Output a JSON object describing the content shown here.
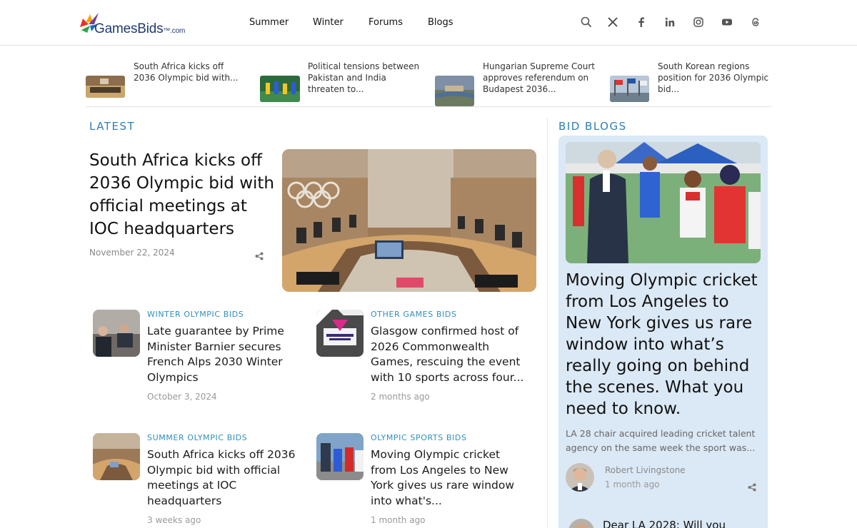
{
  "header": {
    "logo_text": "GamesBids",
    "logo_tld": "™.com",
    "nav": [
      "Summer",
      "Winter",
      "Forums",
      "Blogs"
    ],
    "icons": [
      "search-icon",
      "x-icon",
      "facebook-icon",
      "linkedin-icon",
      "instagram-icon",
      "youtube-icon",
      "threads-icon"
    ]
  },
  "ticker": [
    {
      "text": "South Africa kicks off 2036 Olympic bid with..."
    },
    {
      "text": "Political tensions between Pakistan and India threaten to..."
    },
    {
      "text": "Hungarian Supreme Court approves referendum on Budapest 2036..."
    },
    {
      "text": "South Korean regions position for 2036 Olympic bid..."
    }
  ],
  "latest": {
    "heading": "LATEST",
    "featured": {
      "title": "South Africa kicks off 2036 Olympic bid with official meetings at IOC headquarters",
      "date": "November 22, 2024"
    },
    "cards": [
      {
        "category": "WINTER OLYMPIC BIDS",
        "title": "Late guarantee by Prime Minister Barnier secures French Alps 2030 Winter Olympics",
        "date": "October 3, 2024"
      },
      {
        "category": "OTHER GAMES BIDS",
        "title": "Glasgow confirmed host of 2026 Commonwealth Games, rescuing the event with 10 sports across four...",
        "date": "2 months ago"
      },
      {
        "category": "SUMMER OLYMPIC BIDS",
        "title": "South Africa kicks off 2036 Olympic bid with official meetings at IOC headquarters",
        "date": "3 weeks ago"
      },
      {
        "category": "OLYMPIC SPORTS BIDS",
        "title": "Moving Olympic cricket from Los Angeles to New York gives us rare window into what's...",
        "date": "1 month ago"
      }
    ]
  },
  "blogs": {
    "heading": "BID BLOGS",
    "featured": {
      "title": "Moving Olympic cricket from Los Angeles to New York gives us rare window into what’s really going on behind the scenes. What you need to know.",
      "excerpt": "LA 28 chair acquired leading cricket talent agency on the same week the sport was...",
      "author": "Robert Livingstone",
      "date": "1 month ago"
    },
    "next_title": "Dear LA 2028: Will you"
  },
  "colors": {
    "accent": "#2f7fb5",
    "sidebar_bg": "#dbe8f5",
    "logo_blue": "#1f3b73"
  }
}
